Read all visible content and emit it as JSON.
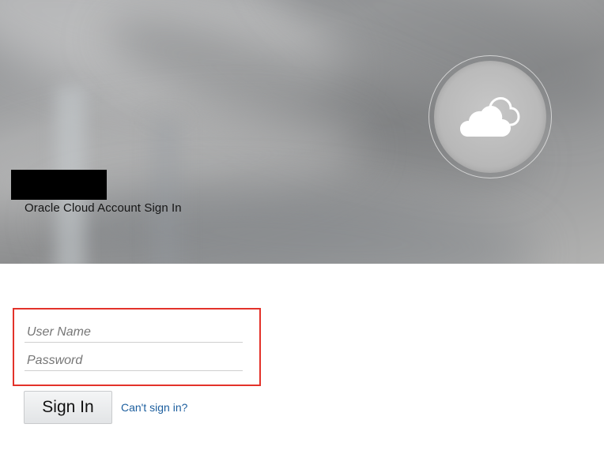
{
  "header": {
    "title": "Oracle Cloud Account Sign In",
    "logo_icon": "cloud-icon",
    "redacted_label": "redacted-name"
  },
  "login_form": {
    "username": {
      "value": "",
      "placeholder": "User Name"
    },
    "password": {
      "value": "",
      "placeholder": "Password"
    },
    "sign_in_label": "Sign In",
    "cant_sign_in_label": "Can't sign in?",
    "highlight_color": "#e3322a"
  },
  "colors": {
    "link": "#1c5e9e",
    "background": "#ffffff",
    "hero_gray": "#9a9b9c"
  }
}
